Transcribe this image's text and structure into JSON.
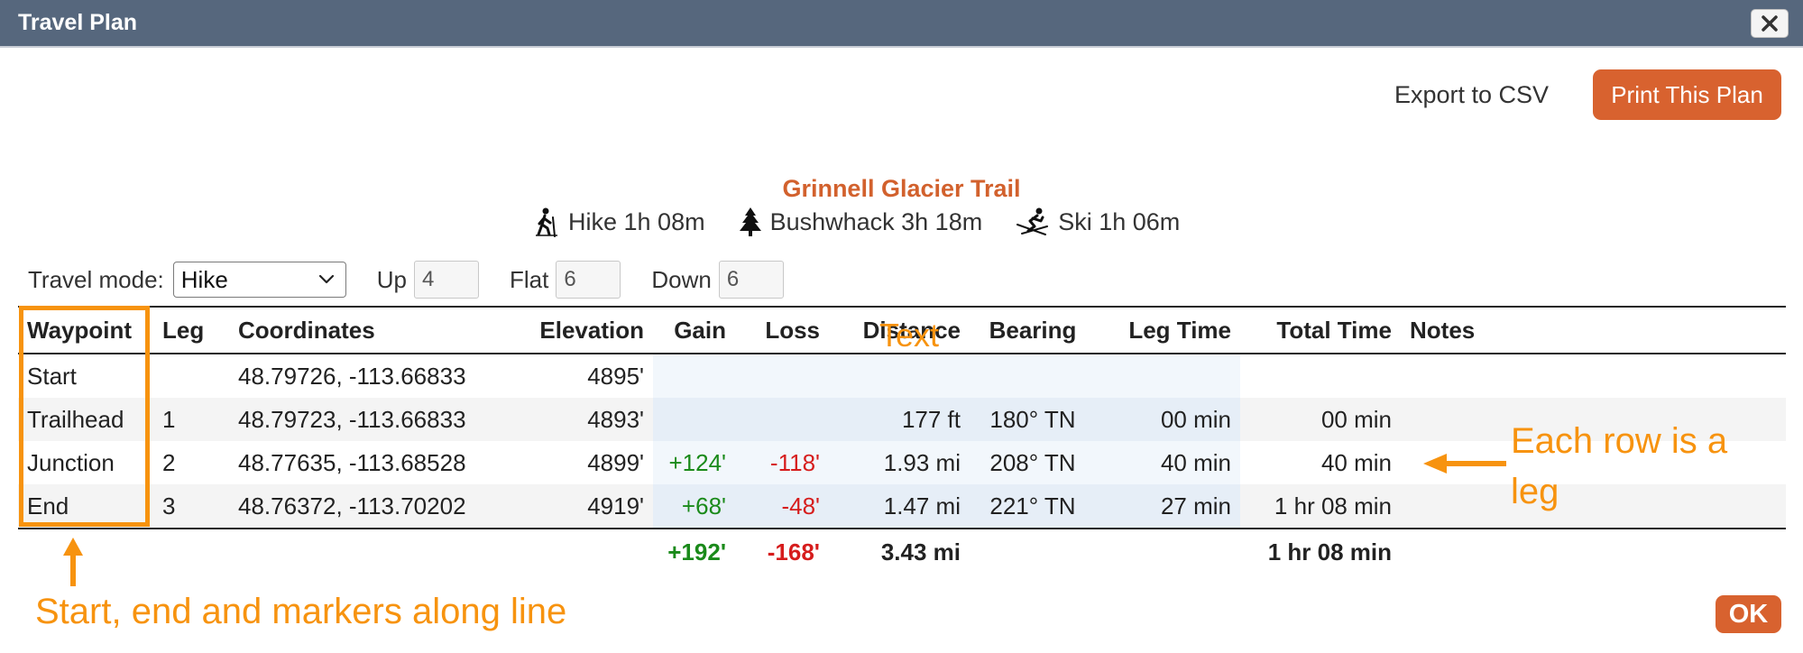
{
  "window": {
    "title": "Travel Plan",
    "close_icon": "close-icon"
  },
  "toolbar": {
    "export_label": "Export to CSV",
    "print_label": "Print This Plan"
  },
  "trail": {
    "name": "Grinnell Glacier Trail",
    "modes": [
      {
        "icon": "hiker-icon",
        "text": "Hike 1h 08m"
      },
      {
        "icon": "tree-icon",
        "text": "Bushwhack 3h 18m"
      },
      {
        "icon": "skier-icon",
        "text": "Ski 1h 06m"
      }
    ]
  },
  "controls": {
    "travel_mode_label": "Travel mode:",
    "travel_mode_value": "Hike",
    "up_label": "Up",
    "up_value": "4",
    "flat_label": "Flat",
    "flat_value": "6",
    "down_label": "Down",
    "down_value": "6"
  },
  "table": {
    "headers": [
      "Waypoint",
      "Leg",
      "Coordinates",
      "Elevation",
      "Gain",
      "Loss",
      "Distance",
      "Bearing",
      "Leg Time",
      "Total Time",
      "Notes"
    ],
    "rows": [
      {
        "waypoint": "Start",
        "leg": "",
        "coordinates": "48.79726, -113.66833",
        "elevation": "4895'",
        "gain": "",
        "loss": "",
        "distance": "",
        "bearing": "",
        "leg_time": "",
        "total_time": "",
        "notes": ""
      },
      {
        "waypoint": "Trailhead",
        "leg": "1",
        "coordinates": "48.79723, -113.66833",
        "elevation": "4893'",
        "gain": "",
        "loss": "",
        "distance": "177 ft",
        "bearing": "180° TN",
        "leg_time": "00 min",
        "total_time": "00 min",
        "notes": ""
      },
      {
        "waypoint": "Junction",
        "leg": "2",
        "coordinates": "48.77635, -113.68528",
        "elevation": "4899'",
        "gain": "+124'",
        "loss": "-118'",
        "distance": "1.93 mi",
        "bearing": "208° TN",
        "leg_time": "40 min",
        "total_time": "40 min",
        "notes": ""
      },
      {
        "waypoint": "End",
        "leg": "3",
        "coordinates": "48.76372, -113.70202",
        "elevation": "4919'",
        "gain": "+68'",
        "loss": "-48'",
        "distance": "1.47 mi",
        "bearing": "221° TN",
        "leg_time": "27 min",
        "total_time": "1 hr 08 min",
        "notes": ""
      }
    ],
    "totals": {
      "gain": "+192'",
      "loss": "-168'",
      "distance": "3.43 mi",
      "total_time": "1 hr 08 min"
    }
  },
  "annotations": {
    "text_label": "Text",
    "row_note": "Each row is a leg",
    "waypoint_note": "Start, end and markers along line",
    "color": "#f7930f"
  },
  "footer": {
    "ok_label": "OK"
  },
  "colors": {
    "titlebar": "#56677d",
    "accent": "#d8622f",
    "gain": "#1a8a1a",
    "loss": "#d61c1c"
  }
}
